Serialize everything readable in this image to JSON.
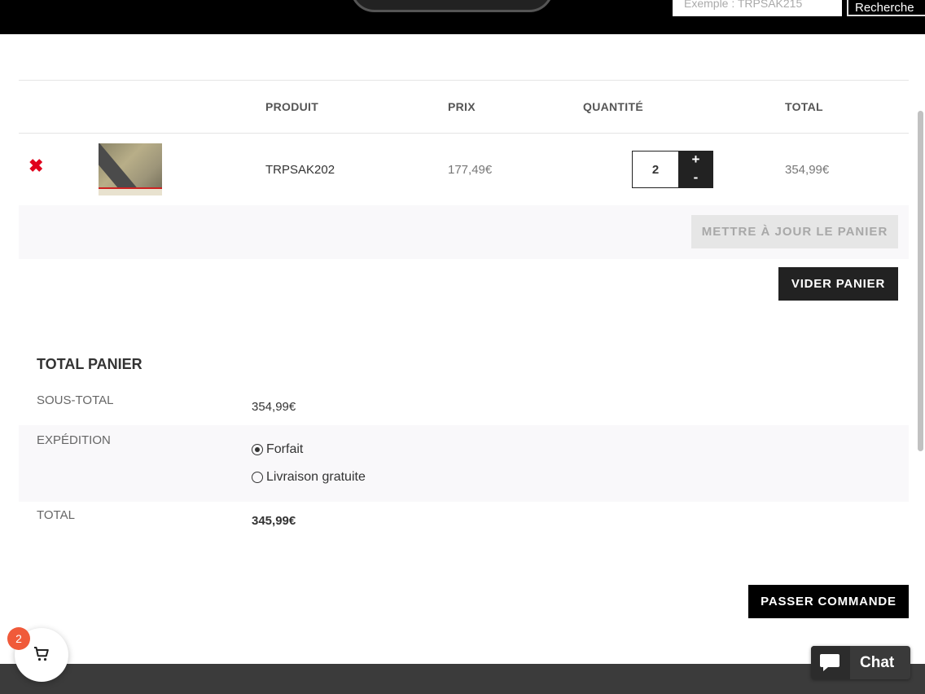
{
  "header": {
    "search_placeholder": "Exemple : TRPSAK215",
    "search_button": "Recherche"
  },
  "cart": {
    "columns": {
      "product": "PRODUIT",
      "price": "PRIX",
      "quantity": "QUANTITÉ",
      "total": "TOTAL"
    },
    "items": [
      {
        "product": "TRPSAK202",
        "price": "177,49€",
        "quantity": "2",
        "total": "354,99€"
      }
    ],
    "qty_plus": "+",
    "qty_minus": "-",
    "remove_symbol": "✖",
    "update_button": "METTRE À JOUR LE PANIER",
    "empty_button": "VIDER PANIER"
  },
  "totals": {
    "title": "TOTAL PANIER",
    "subtotal_label": "SOUS-TOTAL",
    "subtotal_value": "354,99€",
    "shipping_label": "EXPÉDITION",
    "shipping_options": [
      {
        "label": "Forfait",
        "selected": true
      },
      {
        "label": "Livraison gratuite",
        "selected": false
      }
    ],
    "total_label": "TOTAL",
    "total_value": "345,99€"
  },
  "checkout_button": "PASSER COMMANDE",
  "cart_widget": {
    "count": "2",
    "icon": "shopping-cart-icon"
  },
  "chat": {
    "label": "Chat",
    "icon": "chat-bubble-icon"
  },
  "colors": {
    "accent_dark": "#222222",
    "remove_red": "#e0001b",
    "badge": "#f05a3a"
  }
}
